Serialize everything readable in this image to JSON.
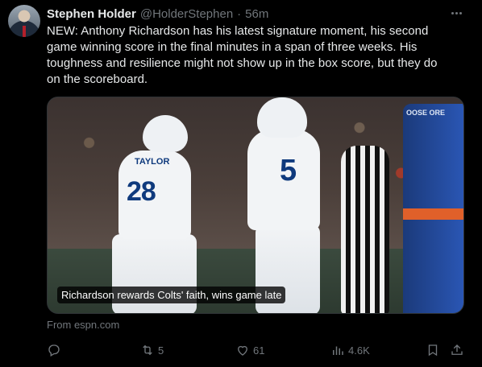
{
  "author": {
    "name": "Stephen Holder",
    "handle": "@HolderStephen",
    "separator": "·",
    "time": "56m"
  },
  "tweet": {
    "text": "NEW: Anthony Richardson has his latest signature moment, his second game winning score in the final minutes in a span of three weeks. His toughness and resilience might not show up in the box score, but they do on the scoreboard."
  },
  "media": {
    "caption": "Richardson rewards Colts' faith, wins game late",
    "jersey_name": "TAYLOR",
    "jersey_number_1": "28",
    "jersey_number_2": "5",
    "banner_text": "OOSE ORE",
    "source": "From espn.com"
  },
  "actions": {
    "reply_count": "",
    "retweet_count": "5",
    "like_count": "61",
    "views_count": "4.6K",
    "icons": [
      "reply-icon",
      "retweet-icon",
      "like-icon",
      "views-icon",
      "bookmark-icon",
      "share-icon"
    ]
  },
  "colors": {
    "background": "#000000",
    "text_primary": "#e7e9ea",
    "text_secondary": "#71767b",
    "colts_blue": "#0f3a7d"
  }
}
